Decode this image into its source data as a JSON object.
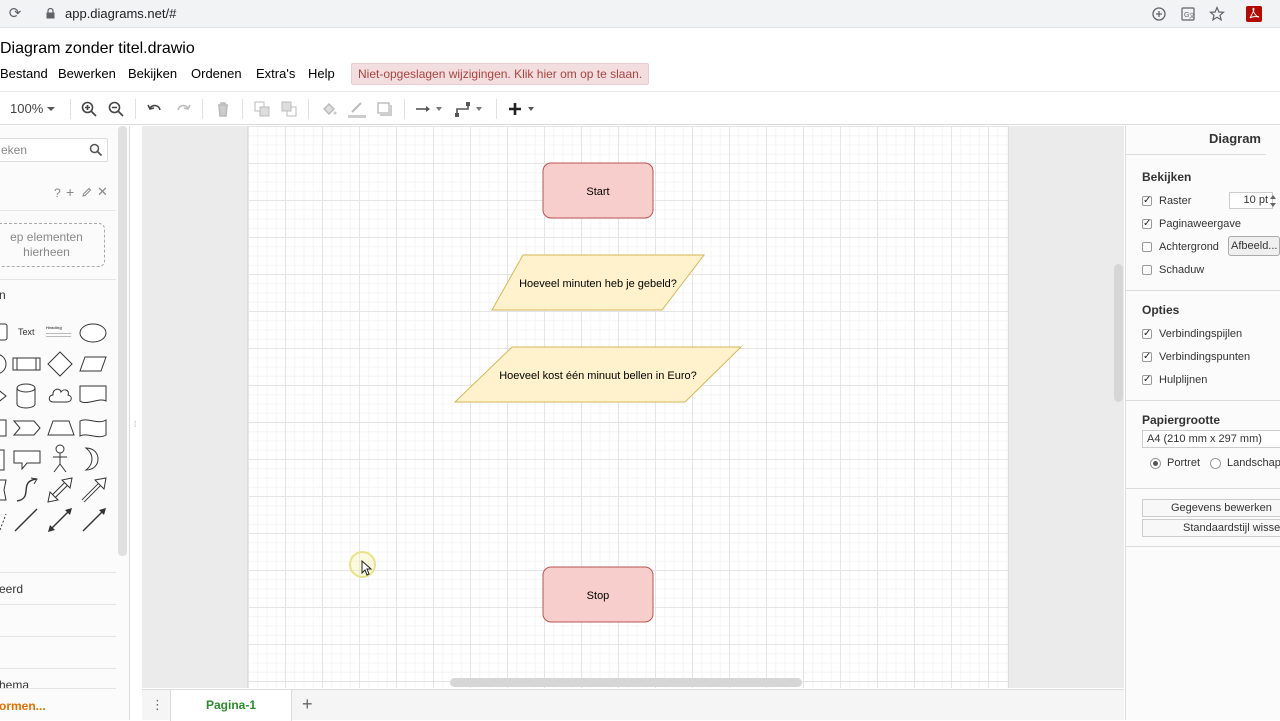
{
  "browser": {
    "url": "app.diagrams.net/#"
  },
  "doc_title": "Diagram zonder titel.drawio",
  "menu": {
    "items": [
      "Bestand",
      "Bewerken",
      "Bekijken",
      "Ordenen",
      "Extra's",
      "Help"
    ],
    "unsaved_notice": "Niet-opgeslagen wijzigingen. Klik hier om op te slaan."
  },
  "toolbar": {
    "zoom": "100%"
  },
  "sidebar": {
    "search_placeholder": "eken",
    "dropzone_text": "ep elementen hierheen",
    "scratchpad_label": "n",
    "text_shape_label": "Text",
    "heading_shape_label": "Heading",
    "section_misc_label": "eerd",
    "section_bottom_label": "hema",
    "more_shapes": "ormen..."
  },
  "diagram": {
    "nodes": [
      "Start",
      "Hoeveel minuten heb je gebeld?",
      "Hoeveel kost één minuut bellen in Euro?",
      "Stop"
    ],
    "colors": {
      "terminal_fill": "#f8cecc",
      "terminal_stroke": "#b85450",
      "io_fill": "#fff2cc",
      "io_stroke": "#d6b656"
    }
  },
  "page_tabs": {
    "active": "Pagina-1"
  },
  "format_panel": {
    "title": "Diagram",
    "view_heading": "Bekijken",
    "grid_label": "Raster",
    "grid_size": "10 pt",
    "page_view_label": "Paginaweergave",
    "background_label": "Achtergrond",
    "image_button": "Afbeeld...",
    "shadow_label": "Schaduw",
    "options_heading": "Opties",
    "connection_arrows": "Verbindingspijlen",
    "connection_points": "Verbindingspunten",
    "guides": "Hulplijnen",
    "paper_heading": "Papiergrootte",
    "paper_size": "A4 (210 mm x 297 mm)",
    "portrait": "Portret",
    "landscape": "Landschap",
    "edit_data_button": "Gegevens bewerken",
    "default_style_button": "Standaardstijl wisse"
  }
}
